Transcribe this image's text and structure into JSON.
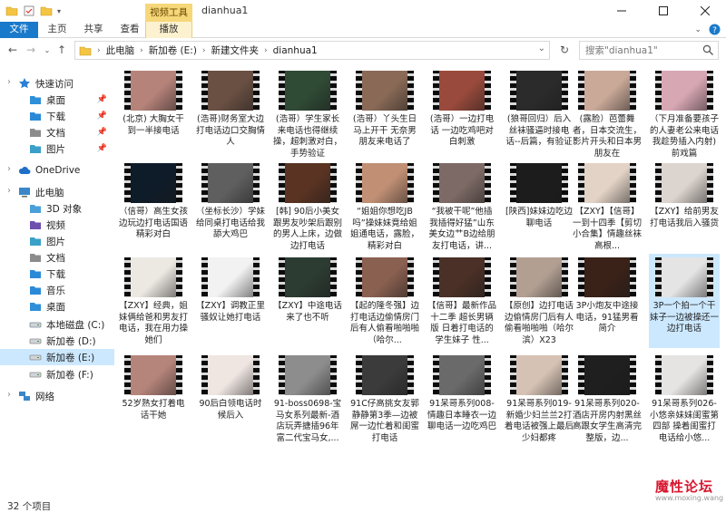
{
  "titlebar": {
    "context_tab": "视频工具",
    "title": "dianhua1"
  },
  "ribbon": {
    "tabs": [
      "文件",
      "主页",
      "共享",
      "查看",
      "播放"
    ]
  },
  "address": {
    "crumbs": [
      "此电脑",
      "新加卷 (E:)",
      "新建文件夹",
      "dianhua1"
    ],
    "search_placeholder": "搜索\"dianhua1\""
  },
  "nav": {
    "items": [
      {
        "label": "快速访问",
        "icon": "star-icon"
      },
      {
        "label": "桌面",
        "icon": "desktop-folder-icon"
      },
      {
        "label": "下载",
        "icon": "download-folder-icon"
      },
      {
        "label": "文档",
        "icon": "documents-folder-icon"
      },
      {
        "label": "图片",
        "icon": "pictures-folder-icon"
      },
      {
        "label": "OneDrive",
        "icon": "cloud-icon"
      },
      {
        "label": "此电脑",
        "icon": "computer-icon"
      },
      {
        "label": "3D 对象",
        "icon": "objects-3d-folder-icon"
      },
      {
        "label": "视频",
        "icon": "videos-folder-icon"
      },
      {
        "label": "图片",
        "icon": "pictures-folder-icon"
      },
      {
        "label": "文档",
        "icon": "documents-folder-icon"
      },
      {
        "label": "下载",
        "icon": "download-folder-icon"
      },
      {
        "label": "音乐",
        "icon": "music-folder-icon"
      },
      {
        "label": "桌面",
        "icon": "desktop-folder-icon"
      },
      {
        "label": "本地磁盘 (C:)",
        "icon": "drive-c-icon"
      },
      {
        "label": "新加卷 (D:)",
        "icon": "drive-icon"
      },
      {
        "label": "新加卷 (E:)",
        "icon": "drive-icon"
      },
      {
        "label": "新加卷 (F:)",
        "icon": "drive-icon"
      },
      {
        "label": "网络",
        "icon": "network-icon"
      }
    ]
  },
  "files": [
    {
      "name": "(北京) 大胸女干到一半接电话",
      "color": "#b6837a"
    },
    {
      "name": "(浩哥)财务室大边打电话边口交胸情人",
      "color": "#6a5043"
    },
    {
      "name": "(浩哥）学生家长来电话也得继续操，超刺激对白，手势验证",
      "color": "#2f4a35"
    },
    {
      "name": "(浩哥）丫头生日 马上开干 无奈男朋友来电话了",
      "color": "#8a6a57"
    },
    {
      "name": "(浩哥）一边打电话 一边吃鸡吧对白刺激",
      "color": "#9a4a3c"
    },
    {
      "name": "(狼哥回归）后入丝袜骚逼时接电话--后篇，有验证",
      "color": "#2b2b2b"
    },
    {
      "name": "(露脸）芭蕾舞者，日本交流生，影片开头和日本男朋友在",
      "color": "#caa998"
    },
    {
      "name": "（下月准备要孩子的人妻老公来电话 我趁势插入内射) 前戏篇",
      "color": "#d8a7b4"
    },
    {
      "name": "（信哥）高生女孩边玩边打电话国语精彩对白",
      "color": "#0e1b29"
    },
    {
      "name": "（坐标长沙）学妹给同桌打电话给我舔大鸡巴",
      "color": "#5f5f5f"
    },
    {
      "name": "[韩] 90后小美女跟男友吵架后跟别的男人上床，边做边打电话",
      "color": "#5a3322"
    },
    {
      "name": "“姐姐你想吃JB吗”操妹妹竟给姐姐通电话，露脸，精彩对白",
      "color": "#c08f74"
    },
    {
      "name": "“我被干呢”他插我插得好猛”山东美女边艹B边给朋友打电话，讲...",
      "color": "#7d6a66"
    },
    {
      "name": "[陕西]妹妹边吃边聊电话",
      "color": "#1c1c1c"
    },
    {
      "name": "【ZXY】【信哥】一到十四季【剪切小合集】情趣丝袜高根...",
      "color": "#e3d3c6"
    },
    {
      "name": "【ZXY】给前男友打电话我后入骚货",
      "color": "#dcd4ce"
    },
    {
      "name": "【ZXY】经典，姐妹俩给爸和男友打电话，我在用力操她们",
      "color": "#ece8e2"
    },
    {
      "name": "【ZXY】调教正里骚奴让她打电话",
      "color": "#f2f2f2"
    },
    {
      "name": "【ZXY】中途电话来了也不听",
      "color": "#2c3c32"
    },
    {
      "name": "【起的隆冬强】边打电话边偷情房门后有人偷看啪啪啪（哈尔...",
      "color": "#8a6050"
    },
    {
      "name": "【信哥】最新作品十二季 超长男辆版 日着打电话的学生妹子 性...",
      "color": "#4a3026"
    },
    {
      "name": "【原创】边打电话边偷情房门后有人偷看啪啪啪（哈尔滨）X23",
      "color": "#b29f92"
    },
    {
      "name": "3P小炮友中途接电话，91猛男看简介",
      "color": "#3a2218"
    },
    {
      "name": "3P一个拍一个干 妹子一边被操还一边打电话",
      "color": "#e4e4e4"
    },
    {
      "name": "52岁熟女打着电话干她",
      "color": "#b5847a"
    },
    {
      "name": "90后白领电话时候后入",
      "color": "#efe6e2"
    },
    {
      "name": "91-boss0698-宝马女系列最新-酒店玩弄搪插96年富二代宝马女,...",
      "color": "#8d8d8d"
    },
    {
      "name": "91C仔高挑女友郭静静第3季—边被屌一边忙着和闺蜜打电话",
      "color": "#3b3b3b"
    },
    {
      "name": "91呆哥系列008-情趣日本睡衣一边聊电话一边吃鸡巴",
      "color": "#6a6a6a"
    },
    {
      "name": "91呆哥系列019-新婚少妇兰兰2打着电话被强上最后少妇都疼",
      "color": "#d6c2b4"
    },
    {
      "name": "91呆哥系列020-酒店开房内射黑丝高跟女学生高清完整版，边...",
      "color": "#1f1f1f"
    },
    {
      "name": "91呆哥系列026-小悠亲妹妹闺蜜第四部 操着闺蜜打电话给小悠...",
      "color": "#e6e4e2"
    }
  ],
  "status": {
    "count": "32 个项目"
  },
  "watermark": {
    "title": "魔性论坛",
    "url": "www.moxing.wang"
  }
}
